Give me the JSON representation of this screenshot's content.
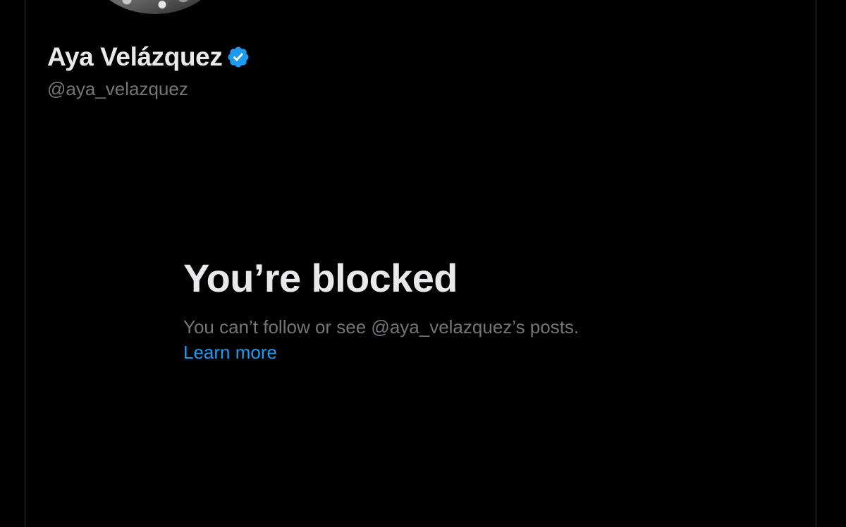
{
  "profile": {
    "display_name": "Aya Velázquez",
    "handle": "@aya_velazquez",
    "verified": true,
    "avatar_icon": "profile-avatar-image"
  },
  "blocked": {
    "title": "You’re blocked",
    "description": "You can’t follow or see @aya_velazquez’s posts.",
    "learn_more": "Learn more"
  },
  "colors": {
    "background": "#000000",
    "primary_text": "#e7e9ea",
    "secondary_text": "#71767b",
    "link": "#1d9bf0",
    "verified_badge": "#1d9bf0",
    "divider": "#2f3336"
  }
}
